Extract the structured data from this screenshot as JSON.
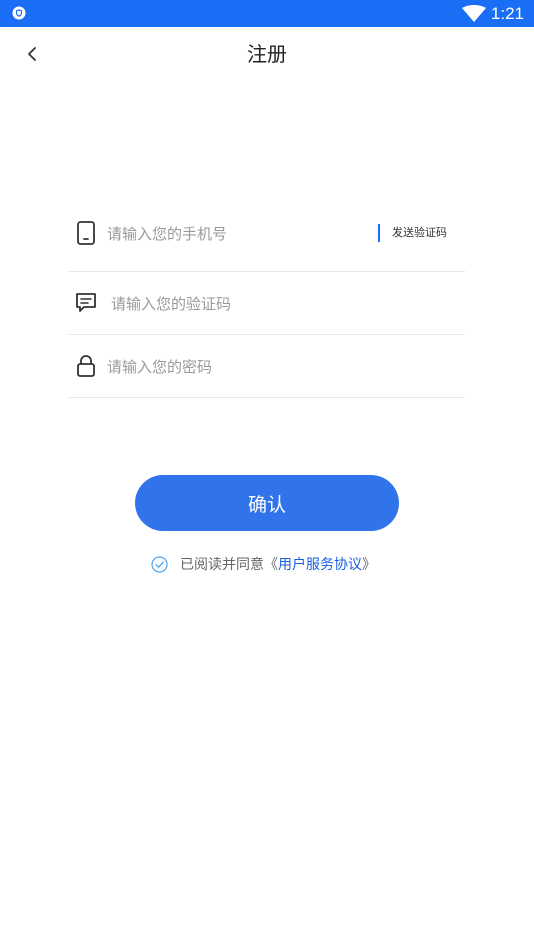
{
  "status_bar": {
    "time": "1:21",
    "bg_color": "#1a6ef5",
    "icons": [
      "shield-icon",
      "wifi-icon"
    ]
  },
  "header": {
    "title": "注册",
    "back_icon": "chevron-left-icon"
  },
  "form": {
    "phone": {
      "placeholder": "请输入您的手机号",
      "value": "",
      "icon": "phone-icon",
      "send_code_label": "发送验证码"
    },
    "code": {
      "placeholder": "请输入您的验证码",
      "value": "",
      "icon": "message-icon"
    },
    "password": {
      "placeholder": "请输入您的密码",
      "value": "",
      "icon": "lock-icon"
    }
  },
  "confirm": {
    "label": "确认",
    "color": "#3173ea"
  },
  "agreement": {
    "checked": true,
    "prefix": "已阅读并同意",
    "open_quote": "《",
    "link_text": "用户服务协议",
    "close_quote": "》",
    "link_color": "#1a5fe0"
  }
}
